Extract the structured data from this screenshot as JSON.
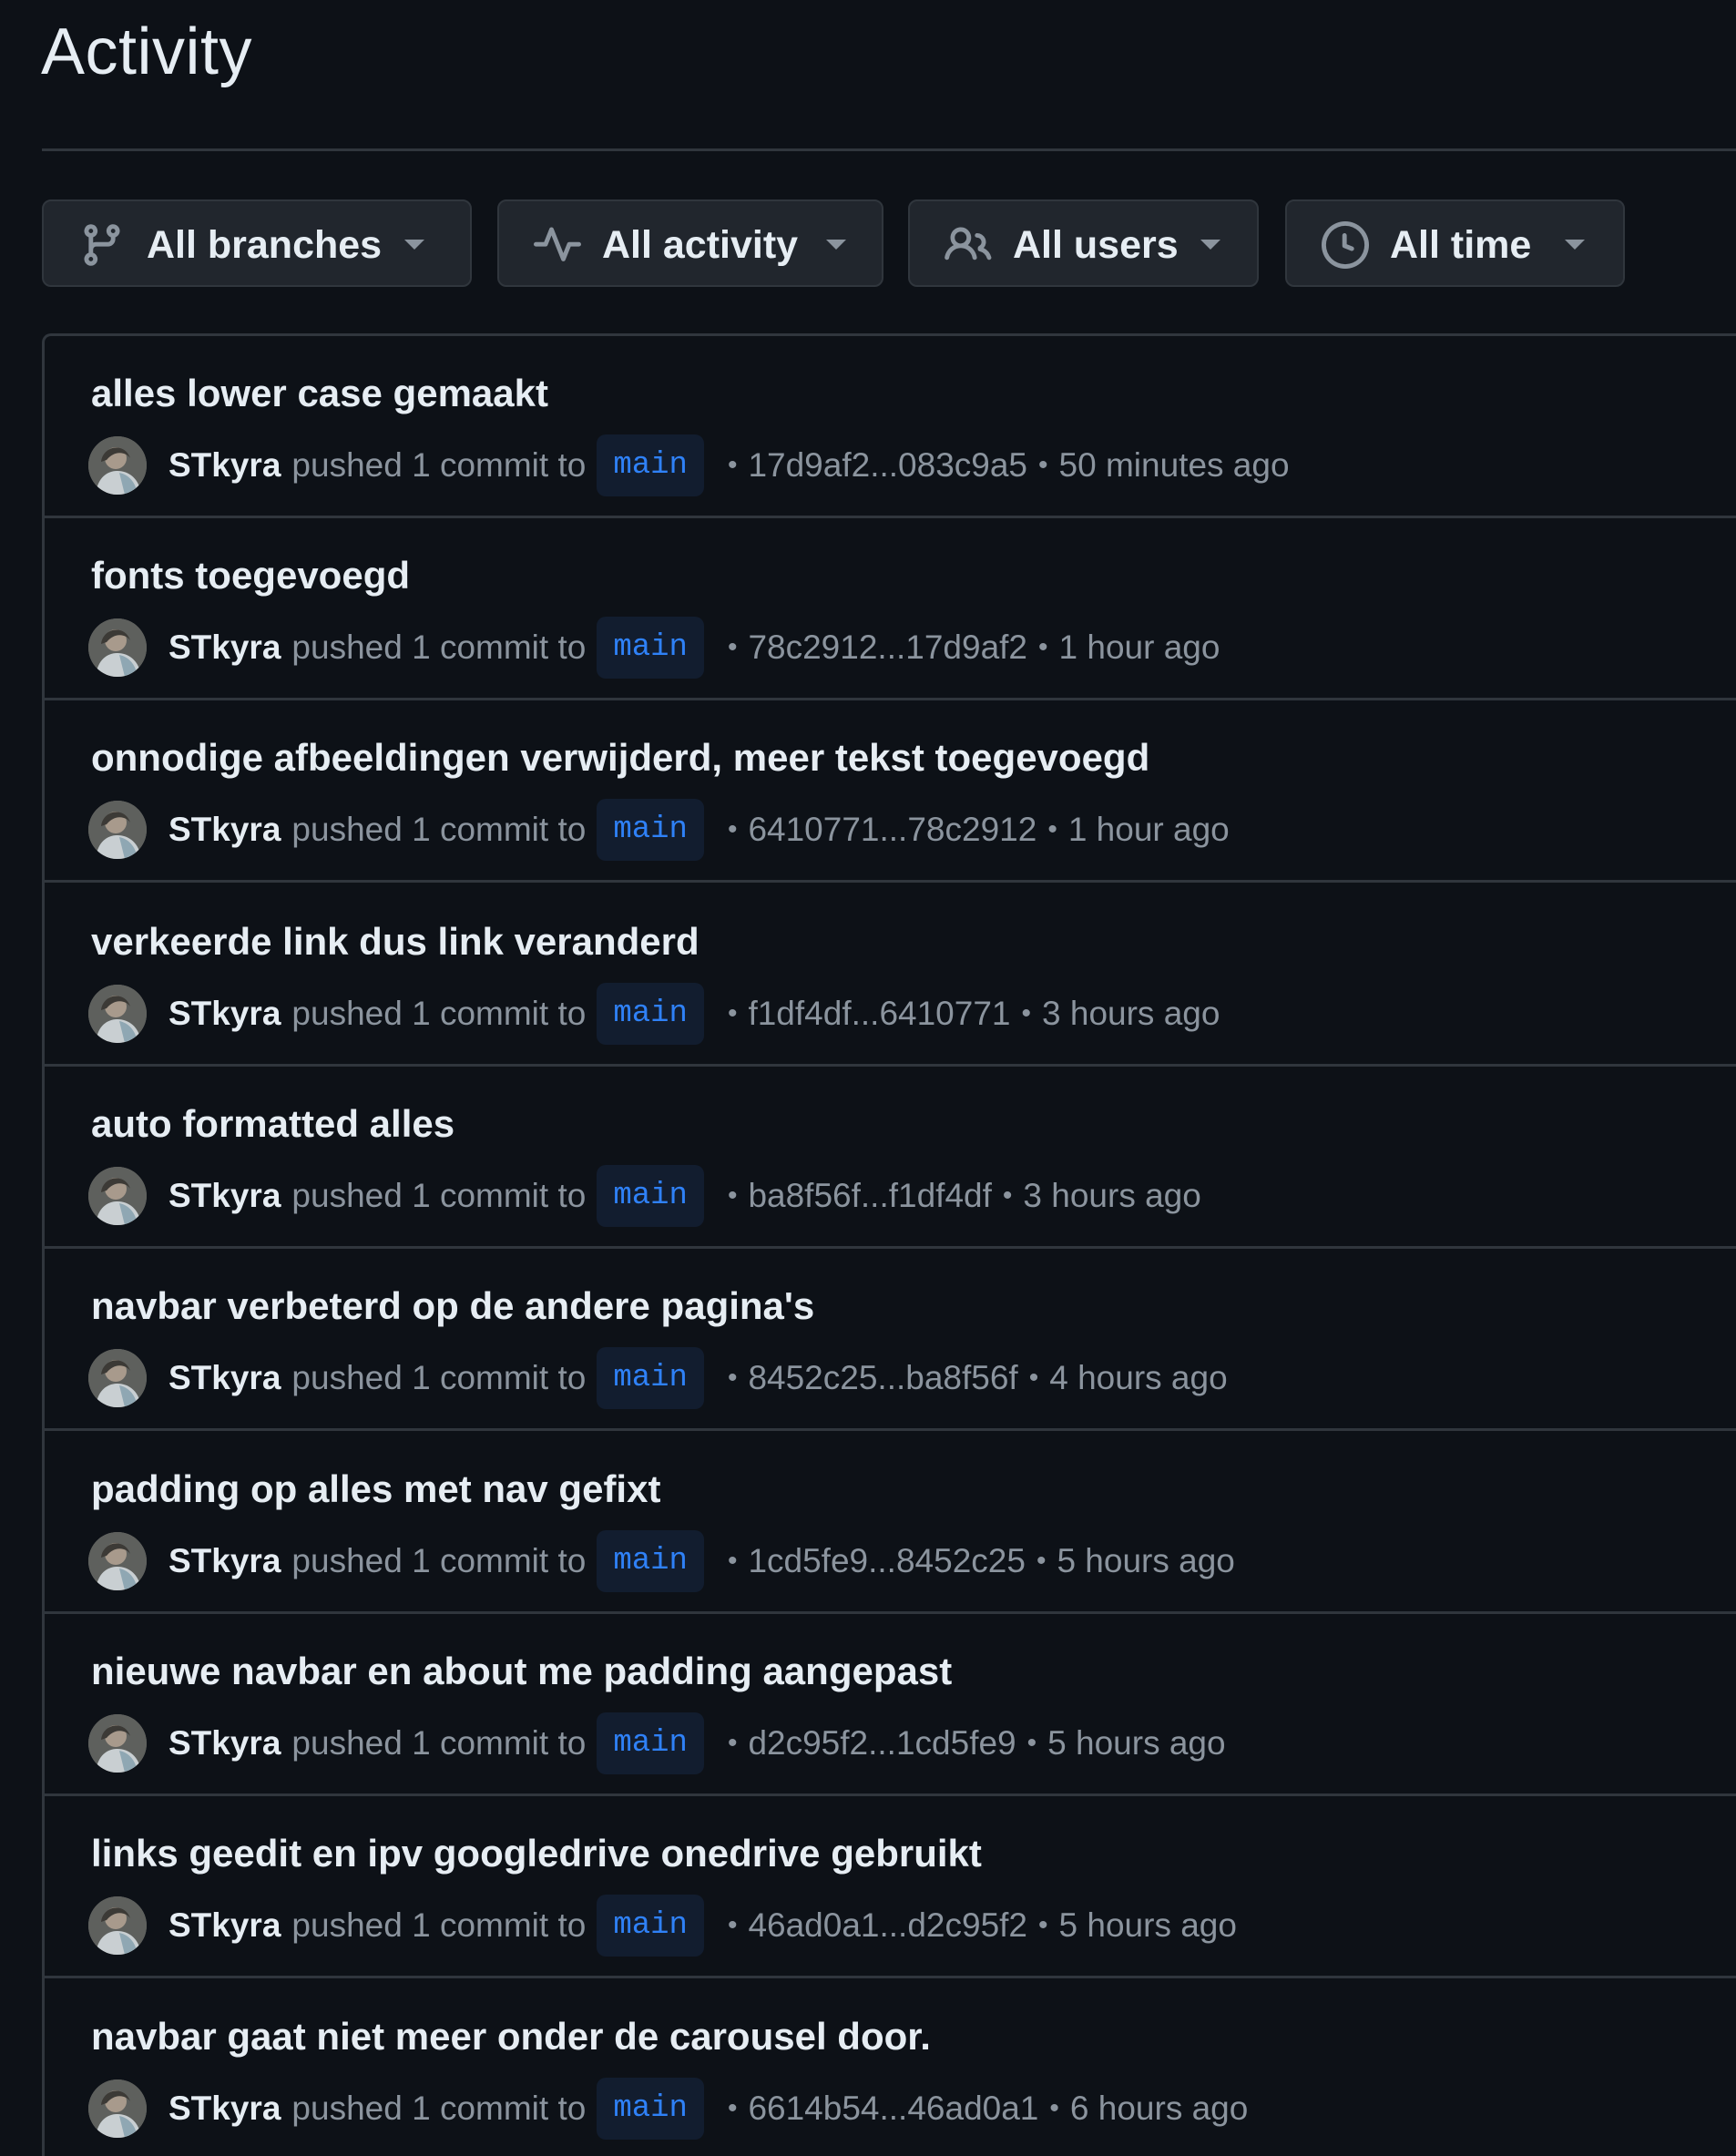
{
  "page": {
    "title": "Activity"
  },
  "filters": [
    {
      "label": "All branches",
      "icon": "git-branch-icon"
    },
    {
      "label": "All activity",
      "icon": "pulse-icon"
    },
    {
      "label": "All users",
      "icon": "people-icon"
    },
    {
      "label": "All time",
      "icon": "clock-icon"
    }
  ],
  "colors": {
    "background": "#0d1117",
    "border": "#30363d",
    "button_bg": "#21262d",
    "text": "#e6edf3",
    "muted": "#8b949e",
    "branch_text": "#2f81f7",
    "branch_bg": "#121d2f"
  },
  "activity": [
    {
      "title": "alles lower case gemaakt",
      "user": "STkyra",
      "action": "pushed 1 commit to",
      "branch": "main",
      "range": "17d9af2...083c9a5",
      "time": "50 minutes ago"
    },
    {
      "title": "fonts toegevoegd",
      "user": "STkyra",
      "action": "pushed 1 commit to",
      "branch": "main",
      "range": "78c2912...17d9af2",
      "time": "1 hour ago"
    },
    {
      "title": "onnodige afbeeldingen verwijderd, meer tekst toegevoegd",
      "user": "STkyra",
      "action": "pushed 1 commit to",
      "branch": "main",
      "range": "6410771...78c2912",
      "time": "1 hour ago"
    },
    {
      "title": "verkeerde link dus link veranderd",
      "user": "STkyra",
      "action": "pushed 1 commit to",
      "branch": "main",
      "range": "f1df4df...6410771",
      "time": "3 hours ago"
    },
    {
      "title": "auto formatted alles",
      "user": "STkyra",
      "action": "pushed 1 commit to",
      "branch": "main",
      "range": "ba8f56f...f1df4df",
      "time": "3 hours ago"
    },
    {
      "title": "navbar verbeterd op de andere pagina's",
      "user": "STkyra",
      "action": "pushed 1 commit to",
      "branch": "main",
      "range": "8452c25...ba8f56f",
      "time": "4 hours ago"
    },
    {
      "title": "padding op alles met nav gefixt",
      "user": "STkyra",
      "action": "pushed 1 commit to",
      "branch": "main",
      "range": "1cd5fe9...8452c25",
      "time": "5 hours ago"
    },
    {
      "title": "nieuwe navbar en about me padding aangepast",
      "user": "STkyra",
      "action": "pushed 1 commit to",
      "branch": "main",
      "range": "d2c95f2...1cd5fe9",
      "time": "5 hours ago"
    },
    {
      "title": "links geedit en ipv googledrive onedrive gebruikt",
      "user": "STkyra",
      "action": "pushed 1 commit to",
      "branch": "main",
      "range": "46ad0a1...d2c95f2",
      "time": "5 hours ago"
    },
    {
      "title": "navbar gaat niet meer onder de carousel door.",
      "user": "STkyra",
      "action": "pushed 1 commit to",
      "branch": "main",
      "range": "6614b54...46ad0a1",
      "time": "6 hours ago"
    }
  ]
}
